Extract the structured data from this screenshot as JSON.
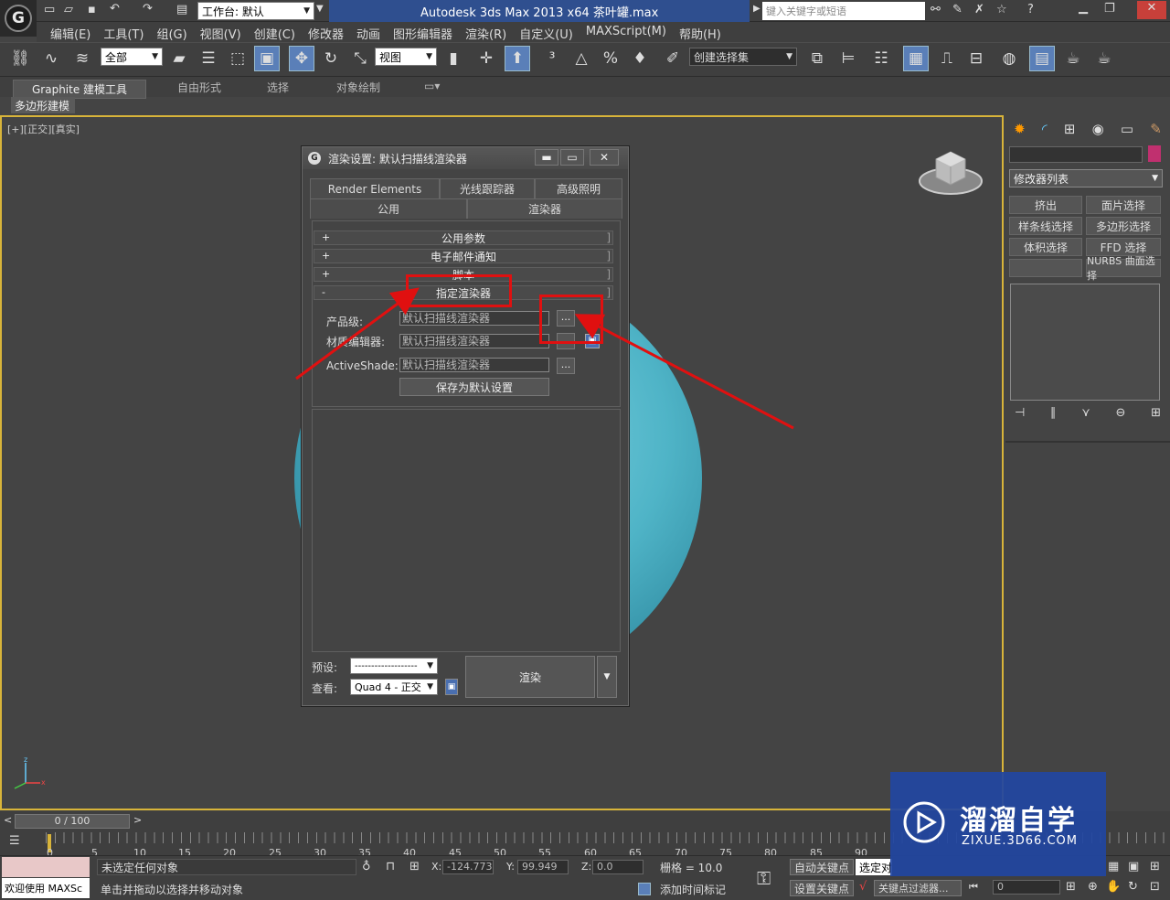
{
  "titlebar": {
    "workspace": "工作台: 默认",
    "app_title": "Autodesk 3ds Max  2013 x64      茶叶罐.max",
    "search_placeholder": "键入关键字或短语"
  },
  "menu": [
    "编辑(E)",
    "工具(T)",
    "组(G)",
    "视图(V)",
    "创建(C)",
    "修改器",
    "动画",
    "图形编辑器",
    "渲染(R)",
    "自定义(U)",
    "MAXScript(M)",
    "帮助(H)"
  ],
  "toolbar": {
    "selection_filter": "全部",
    "ref_coord": "视图",
    "named_selection": "创建选择集"
  },
  "ribbon": {
    "tabs": [
      "Graphite 建模工具",
      "自由形式",
      "选择",
      "对象绘制"
    ],
    "subtab": "多边形建模"
  },
  "viewport": {
    "label": "[+][正交][真实]"
  },
  "command_panel": {
    "modifier_list": "修改器列表",
    "buttons": [
      "挤出",
      "面片选择",
      "样条线选择",
      "多边形选择",
      "体积选择",
      "FFD 选择",
      "NURBS 曲面选择"
    ]
  },
  "dialog": {
    "title": "渲染设置: 默认扫描线渲染器",
    "tabs_row1": [
      "Render Elements",
      "光线跟踪器",
      "高级照明"
    ],
    "tabs_row2": [
      "公用",
      "渲染器"
    ],
    "rollouts": [
      {
        "sign": "+",
        "label": "公用参数"
      },
      {
        "sign": "+",
        "label": "电子邮件通知"
      },
      {
        "sign": "+",
        "label": "脚本"
      },
      {
        "sign": "-",
        "label": "指定渲染器"
      }
    ],
    "assign": {
      "production_label": "产品级:",
      "production_value": "默认扫描线渲染器",
      "material_label": "材质编辑器:",
      "material_value": "默认扫描线渲染器",
      "activeshade_label": "ActiveShade:",
      "activeshade_value": "默认扫描线渲染器",
      "dots": "...",
      "save_default": "保存为默认设置"
    },
    "preset_label": "预设:",
    "preset_value": "-------------------",
    "view_label": "查看:",
    "view_value": "Quad 4 - 正交",
    "render_button": "渲染"
  },
  "timeline": {
    "frame": "0 / 100",
    "ticks": [
      "0",
      "5",
      "10",
      "15",
      "20",
      "25",
      "30",
      "35",
      "40",
      "45",
      "50",
      "55",
      "60",
      "65",
      "70",
      "75",
      "80",
      "85",
      "90"
    ]
  },
  "status": {
    "welcome": "欢迎使用 MAXSc",
    "selection": "未选定任何对象",
    "prompt": "单击并拖动以选择并移动对象",
    "x_label": "X:",
    "x_value": "-124.773",
    "y_label": "Y:",
    "y_value": "99.949",
    "z_label": "Z:",
    "z_value": "0.0",
    "grid": "栅格 = 10.0",
    "auto_key": "自动关键点",
    "set_key": "设置关键点",
    "selected": "选定对",
    "key_filters": "关键点过滤器...",
    "add_time_tag": "添加时间标记",
    "frame_field": "0"
  },
  "watermark": {
    "brand": "溜溜自学",
    "url": "ZIXUE.3D66.COM"
  },
  "colors": {
    "annotation": "#e01010",
    "sphere": "#4fb4c7",
    "viewport_border": "#d8b43a"
  }
}
